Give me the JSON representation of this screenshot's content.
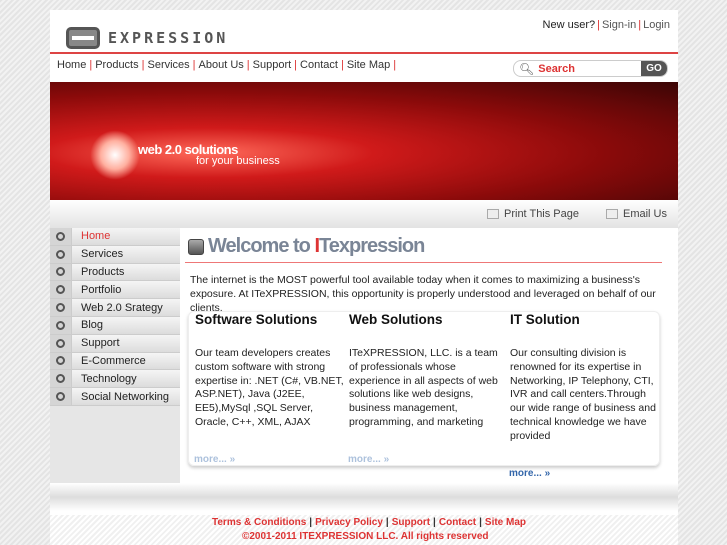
{
  "header": {
    "logo_text": "EXPRESSION",
    "new_user": "New user?",
    "signin": "Sign-in",
    "login": "Login"
  },
  "nav": [
    "Home",
    "Products",
    "Services",
    "About Us",
    "Support",
    "Contact",
    "Site Map"
  ],
  "search": {
    "placeholder": "Search",
    "go": "GO"
  },
  "banner": {
    "line1": "web 2.0 solutions",
    "line2": "for your business"
  },
  "toolbar": {
    "print": "Print This Page",
    "email": "Email Us"
  },
  "sidebar": {
    "active": "Home",
    "items": [
      "Home",
      "Services",
      "Products",
      "Portfolio",
      "Web 2.0 Srategy",
      "Blog",
      "Support",
      "E-Commerce",
      "Technology",
      "Social Networking"
    ]
  },
  "main": {
    "title_prefix": "Welcome to ",
    "title_brand_i": "I",
    "title_rest": "Texpression",
    "intro": "The internet is the MOST powerful tool available today when it comes to maximizing a business's exposure. At ITeXPRESSION, this opportunity is properly understood and leveraged on behalf of our clients.",
    "columns": [
      {
        "title": "Software Solutions",
        "text": "Our team developers creates custom software with strong expertise in: .NET (C#, VB.NET, ASP.NET), Java (J2EE, EE5),MySql ,SQL Server, Oracle, C++, XML, AJAX",
        "more": "more... »"
      },
      {
        "title": "Web Solutions",
        "text": "ITeXPRESSION, LLC. is a team of professionals whose experience in all aspects of web solutions like web designs, business management, programming, and marketing",
        "more": "more... »"
      },
      {
        "title": "IT Solution",
        "text": "Our consulting division is renowned for its expertise in Networking, IP Telephony, CTI, IVR and call centers.Through our wide range of business and technical knowledge we have provided",
        "more": "more... »"
      }
    ]
  },
  "footer": {
    "links": [
      "Terms & Conditions",
      "Privacy Policy",
      "Support",
      "Contact",
      "Site Map"
    ],
    "copyright": "©2001-2011 ITEXPRESSION LLC. All rights reserved"
  },
  "colors": {
    "accent": "#dd3333",
    "title": "#7a8596",
    "link": "#3366aa"
  }
}
